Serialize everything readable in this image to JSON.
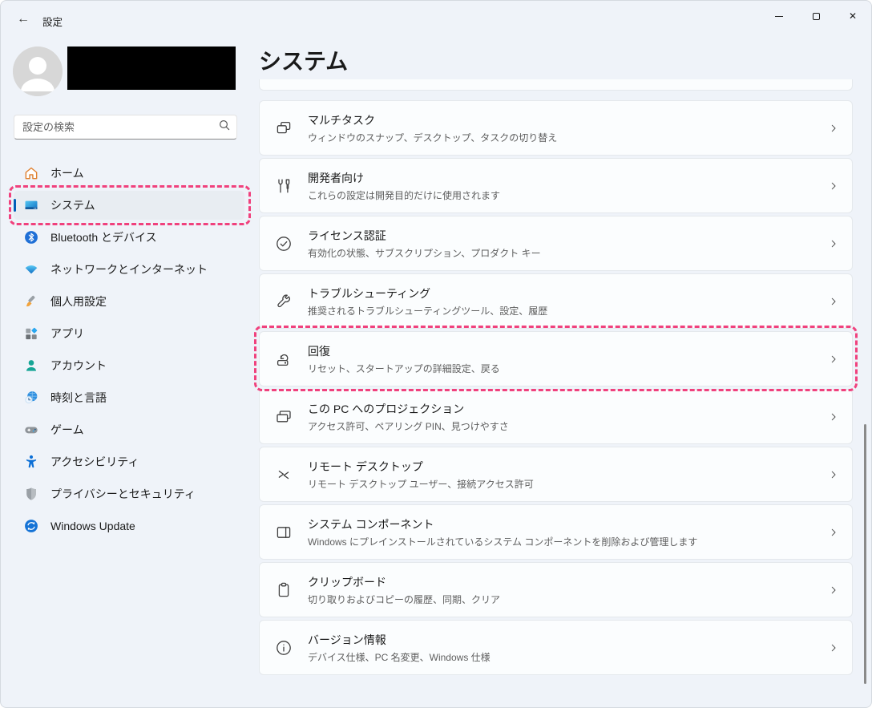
{
  "titlebar": {
    "back_glyph": "←",
    "title": "設定"
  },
  "sidebar": {
    "search_placeholder": "設定の検索",
    "items": [
      {
        "id": "home",
        "label": "ホーム",
        "icon": "home-icon"
      },
      {
        "id": "system",
        "label": "システム",
        "icon": "system-icon",
        "selected": true,
        "highlighted": true
      },
      {
        "id": "bluetooth",
        "label": "Bluetooth とデバイス",
        "icon": "bluetooth-icon"
      },
      {
        "id": "network",
        "label": "ネットワークとインターネット",
        "icon": "network-icon"
      },
      {
        "id": "personalization",
        "label": "個人用設定",
        "icon": "personalization-icon"
      },
      {
        "id": "apps",
        "label": "アプリ",
        "icon": "apps-icon"
      },
      {
        "id": "accounts",
        "label": "アカウント",
        "icon": "accounts-icon"
      },
      {
        "id": "time-language",
        "label": "時刻と言語",
        "icon": "time-language-icon"
      },
      {
        "id": "gaming",
        "label": "ゲーム",
        "icon": "gaming-icon"
      },
      {
        "id": "accessibility",
        "label": "アクセシビリティ",
        "icon": "accessibility-icon"
      },
      {
        "id": "privacy",
        "label": "プライバシーとセキュリティ",
        "icon": "privacy-icon"
      },
      {
        "id": "windows-update",
        "label": "Windows Update",
        "icon": "windows-update-icon"
      }
    ]
  },
  "main": {
    "heading": "システム",
    "cards": [
      {
        "id": "multitasking",
        "title": "マルチタスク",
        "subtitle": "ウィンドウのスナップ、デスクトップ、タスクの切り替え",
        "icon": "multitasking-icon"
      },
      {
        "id": "developers",
        "title": "開発者向け",
        "subtitle": "これらの設定は開発目的だけに使用されます",
        "icon": "developers-icon"
      },
      {
        "id": "activation",
        "title": "ライセンス認証",
        "subtitle": "有効化の状態、サブスクリプション、プロダクト キー",
        "icon": "activation-icon"
      },
      {
        "id": "troubleshoot",
        "title": "トラブルシューティング",
        "subtitle": "推奨されるトラブルシューティングツール、設定、履歴",
        "icon": "troubleshoot-icon"
      },
      {
        "id": "recovery",
        "title": "回復",
        "subtitle": "リセット、スタートアップの詳細設定、戻る",
        "icon": "recovery-icon",
        "highlighted": true
      },
      {
        "id": "projection",
        "title": "この PC へのプロジェクション",
        "subtitle": "アクセス許可、ペアリング PIN、見つけやすさ",
        "icon": "projection-icon"
      },
      {
        "id": "remote-desktop",
        "title": "リモート デスクトップ",
        "subtitle": "リモート デスクトップ ユーザー、接続アクセス許可",
        "icon": "remote-desktop-icon"
      },
      {
        "id": "system-components",
        "title": "システム コンポーネント",
        "subtitle": "Windows にプレインストールされているシステム コンポーネントを削除および管理します",
        "icon": "system-components-icon"
      },
      {
        "id": "clipboard",
        "title": "クリップボード",
        "subtitle": "切り取りおよびコピーの履歴、同期、クリア",
        "icon": "clipboard-icon"
      },
      {
        "id": "about",
        "title": "バージョン情報",
        "subtitle": "デバイス仕様、PC 名変更、Windows 仕様",
        "icon": "about-icon"
      }
    ]
  },
  "colors": {
    "accent": "#005fb8",
    "highlight_dashed": "#f0417d",
    "window_background": "#eff3f9",
    "card_background": "#fbfdfe",
    "scrollbar": "#8a8a8a"
  }
}
